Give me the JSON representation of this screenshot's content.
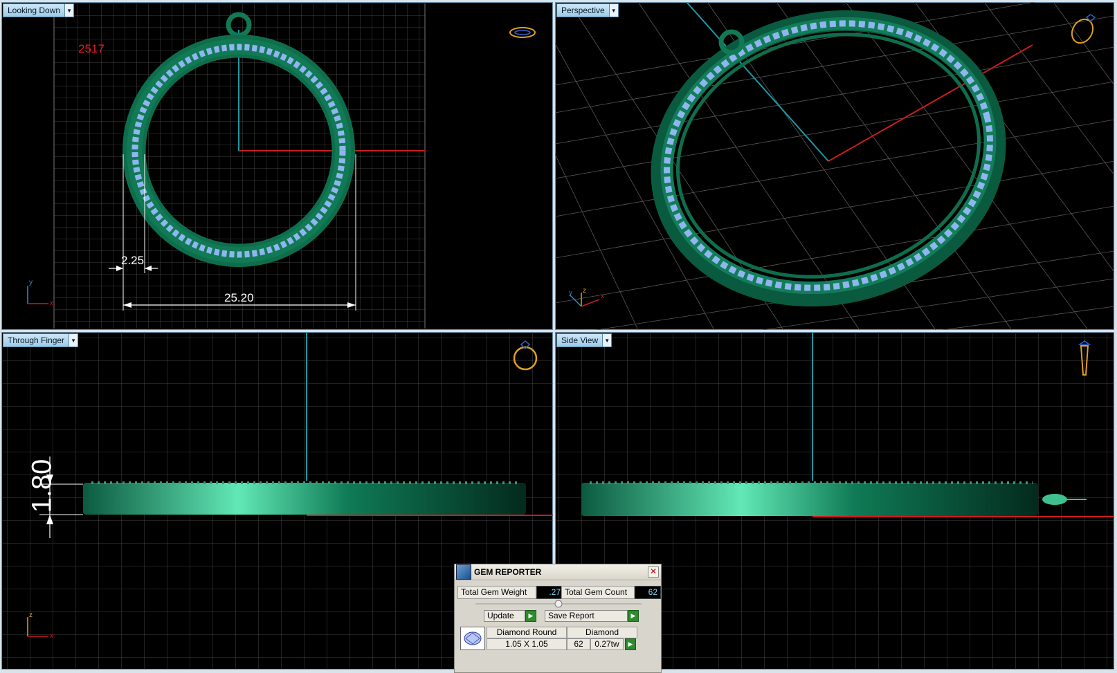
{
  "viewports": {
    "top_left": {
      "label": "Looking Down",
      "model_number": "2517",
      "dim_width": "2.25",
      "dim_diameter": "25.20",
      "axis_x": "x",
      "axis_y": "y"
    },
    "top_right": {
      "label": "Perspective",
      "axis_x": "x",
      "axis_y": "y",
      "axis_z": "z"
    },
    "bottom_left": {
      "label": "Through Finger",
      "dim_height": "1.80",
      "axis_x": "x",
      "axis_z": "z"
    },
    "bottom_right": {
      "label": "Side View"
    }
  },
  "gem_reporter": {
    "title": "GEM REPORTER",
    "close": "✕",
    "total_weight_label": "Total Gem Weight",
    "total_weight_value": ".27",
    "total_count_label": "Total Gem Count",
    "total_count_value": "62",
    "update_label": "Update",
    "save_report_label": "Save Report",
    "rows": [
      {
        "shape": "Diamond Round",
        "size": "1.05 X 1.05",
        "material": "Diamond",
        "count": "62",
        "weight": "0.27tw"
      }
    ]
  },
  "colors": {
    "metal": "#0f7a55",
    "gem": "#8fb6f0",
    "grid": "#5a5a5a",
    "axis_x": "#c81e1e",
    "axis_y": "#1a9aa8",
    "label_tab": "#9ccbe8"
  }
}
